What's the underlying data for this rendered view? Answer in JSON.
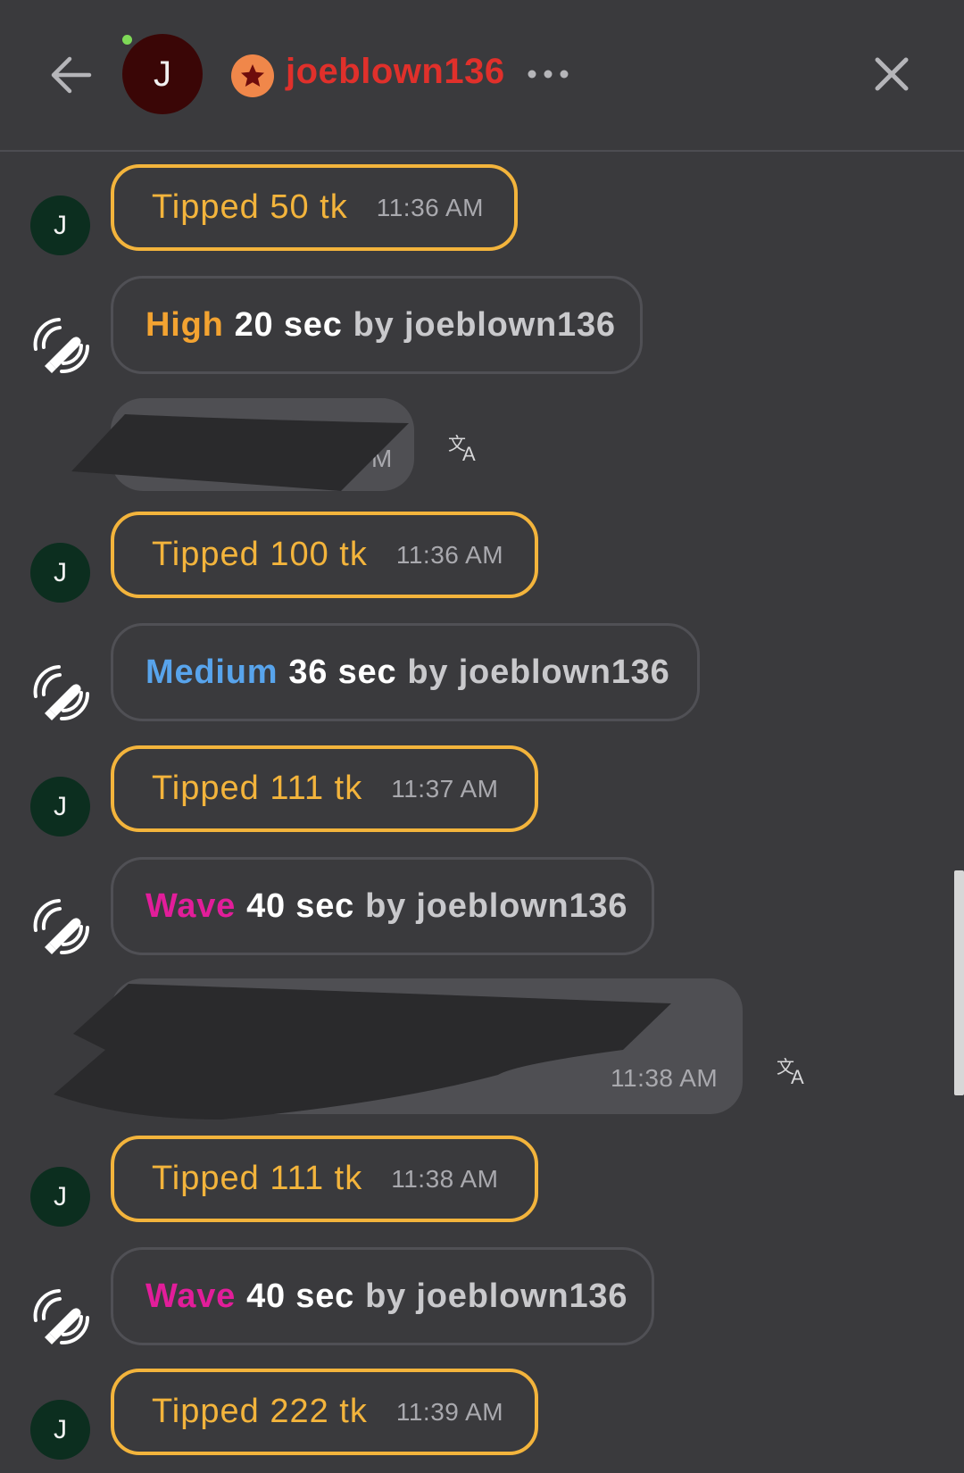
{
  "header": {
    "avatar_letter": "J",
    "username": "joeblown136"
  },
  "messages": [
    {
      "kind": "tip",
      "avatar_letter": "J",
      "text": "Tipped 50 tk",
      "time": "11:36 AM"
    },
    {
      "kind": "vibe",
      "level": "High",
      "duration": "20 sec",
      "by": "by joeblown136"
    },
    {
      "kind": "message",
      "time_partial": "M"
    },
    {
      "kind": "tip",
      "avatar_letter": "J",
      "text": "Tipped 100 tk",
      "time": "11:36 AM"
    },
    {
      "kind": "vibe",
      "level": "Medium",
      "duration": "36 sec",
      "by": "by joeblown136"
    },
    {
      "kind": "tip",
      "avatar_letter": "J",
      "text": "Tipped 111 tk",
      "time": "11:37 AM"
    },
    {
      "kind": "vibe",
      "level": "Wave",
      "duration": "40 sec",
      "by": "by joeblown136"
    },
    {
      "kind": "message",
      "time": "11:38 AM"
    },
    {
      "kind": "tip",
      "avatar_letter": "J",
      "text": "Tipped 111 tk",
      "time": "11:38 AM"
    },
    {
      "kind": "vibe",
      "level": "Wave",
      "duration": "40 sec",
      "by": "by joeblown136"
    },
    {
      "kind": "tip",
      "avatar_letter": "J",
      "text": "Tipped 222 tk",
      "time": "11:39 AM"
    }
  ],
  "colors": {
    "background": "#3a3a3d",
    "username": "#e0302b",
    "tip_accent": "#f3b43c",
    "level_high": "#f3a331",
    "level_medium": "#58a4ec",
    "level_wave": "#e21d9a",
    "online": "#7ed957"
  },
  "icons": [
    "back-arrow-icon",
    "star-badge-icon",
    "more-icon",
    "close-icon",
    "vibration-icon",
    "translate-icon"
  ]
}
